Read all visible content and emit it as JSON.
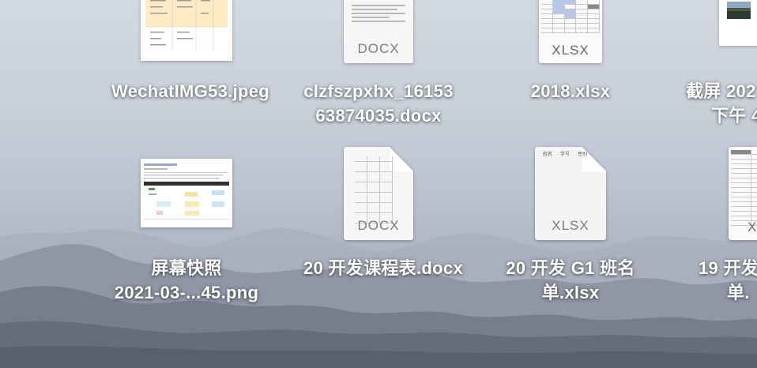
{
  "desktop": {
    "files": [
      {
        "id": "wechat",
        "name_lines": [
          "WechatIMG53.jpeg"
        ],
        "kind": "jpeg"
      },
      {
        "id": "clzf",
        "name_lines": [
          "clzfszpxhx_16153",
          "63874035.docx"
        ],
        "kind": "docx",
        "badge": "DOCX"
      },
      {
        "id": "x2018",
        "name_lines": [
          "2018.xlsx"
        ],
        "kind": "xlsx",
        "badge": "XLSX"
      },
      {
        "id": "screenshot-top",
        "name_lines": [
          "截屏 202",
          "下午 4"
        ],
        "kind": "png"
      },
      {
        "id": "screenshot-0321",
        "name_lines": [
          "屏幕快照",
          "2021-03-...45.png"
        ],
        "kind": "png"
      },
      {
        "id": "course",
        "name_lines": [
          "20 开发课程表.docx"
        ],
        "kind": "docx",
        "badge": "DOCX"
      },
      {
        "id": "g1",
        "name_lines": [
          "20 开发 G1 班名",
          "单.xlsx"
        ],
        "kind": "xlsx",
        "badge": "XLSX"
      },
      {
        "id": "x19",
        "name_lines": [
          "19 开发",
          "单."
        ],
        "kind": "xlsx",
        "badge": "X"
      }
    ],
    "thumb_texts": {
      "g1_headers": [
        "姓名",
        "学号",
        "性别"
      ]
    }
  }
}
